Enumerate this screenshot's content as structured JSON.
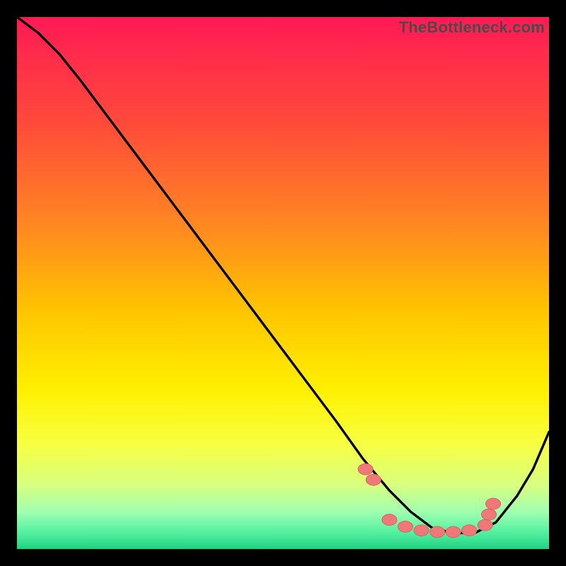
{
  "watermark": "TheBottleneck.com",
  "colors": {
    "frame": "#000000",
    "curve": "#000000",
    "dot_fill": "#f07878",
    "dot_stroke": "#d86060",
    "gradient_stops": [
      {
        "y": 0.0,
        "c": "#ff1a55"
      },
      {
        "y": 0.2,
        "c": "#ff4a3a"
      },
      {
        "y": 0.4,
        "c": "#ff8a20"
      },
      {
        "y": 0.55,
        "c": "#ffc400"
      },
      {
        "y": 0.7,
        "c": "#fff000"
      },
      {
        "y": 0.8,
        "c": "#f8ff40"
      },
      {
        "y": 0.88,
        "c": "#d8ff80"
      },
      {
        "y": 0.93,
        "c": "#a0ffb0"
      },
      {
        "y": 0.97,
        "c": "#50f0a0"
      },
      {
        "y": 1.0,
        "c": "#20d080"
      }
    ]
  },
  "chart_data": {
    "type": "line",
    "title": "",
    "xlabel": "",
    "ylabel": "",
    "xlim": [
      0,
      100
    ],
    "ylim": [
      0,
      100
    ],
    "note": "x/y are read in plot-area percentage coordinates; y=0 is top.",
    "series": [
      {
        "name": "curve",
        "x": [
          0,
          4,
          8,
          12,
          18,
          24,
          30,
          36,
          42,
          48,
          54,
          60,
          65,
          70,
          74,
          78,
          82,
          86,
          90,
          94,
          97,
          100
        ],
        "y": [
          0,
          3,
          7,
          12,
          20,
          28,
          36,
          44,
          52,
          60,
          68,
          76,
          83,
          89,
          93,
          96,
          97,
          97,
          95,
          90,
          85,
          78
        ]
      }
    ],
    "markers": {
      "name": "dots-on-curve",
      "x": [
        65.5,
        67.0,
        70.0,
        73.0,
        76.0,
        79.0,
        82.0,
        85.0,
        88.0,
        88.7,
        89.5
      ],
      "y": [
        85.0,
        87.0,
        94.5,
        95.8,
        96.5,
        96.8,
        96.8,
        96.5,
        95.5,
        93.5,
        91.5
      ]
    }
  }
}
